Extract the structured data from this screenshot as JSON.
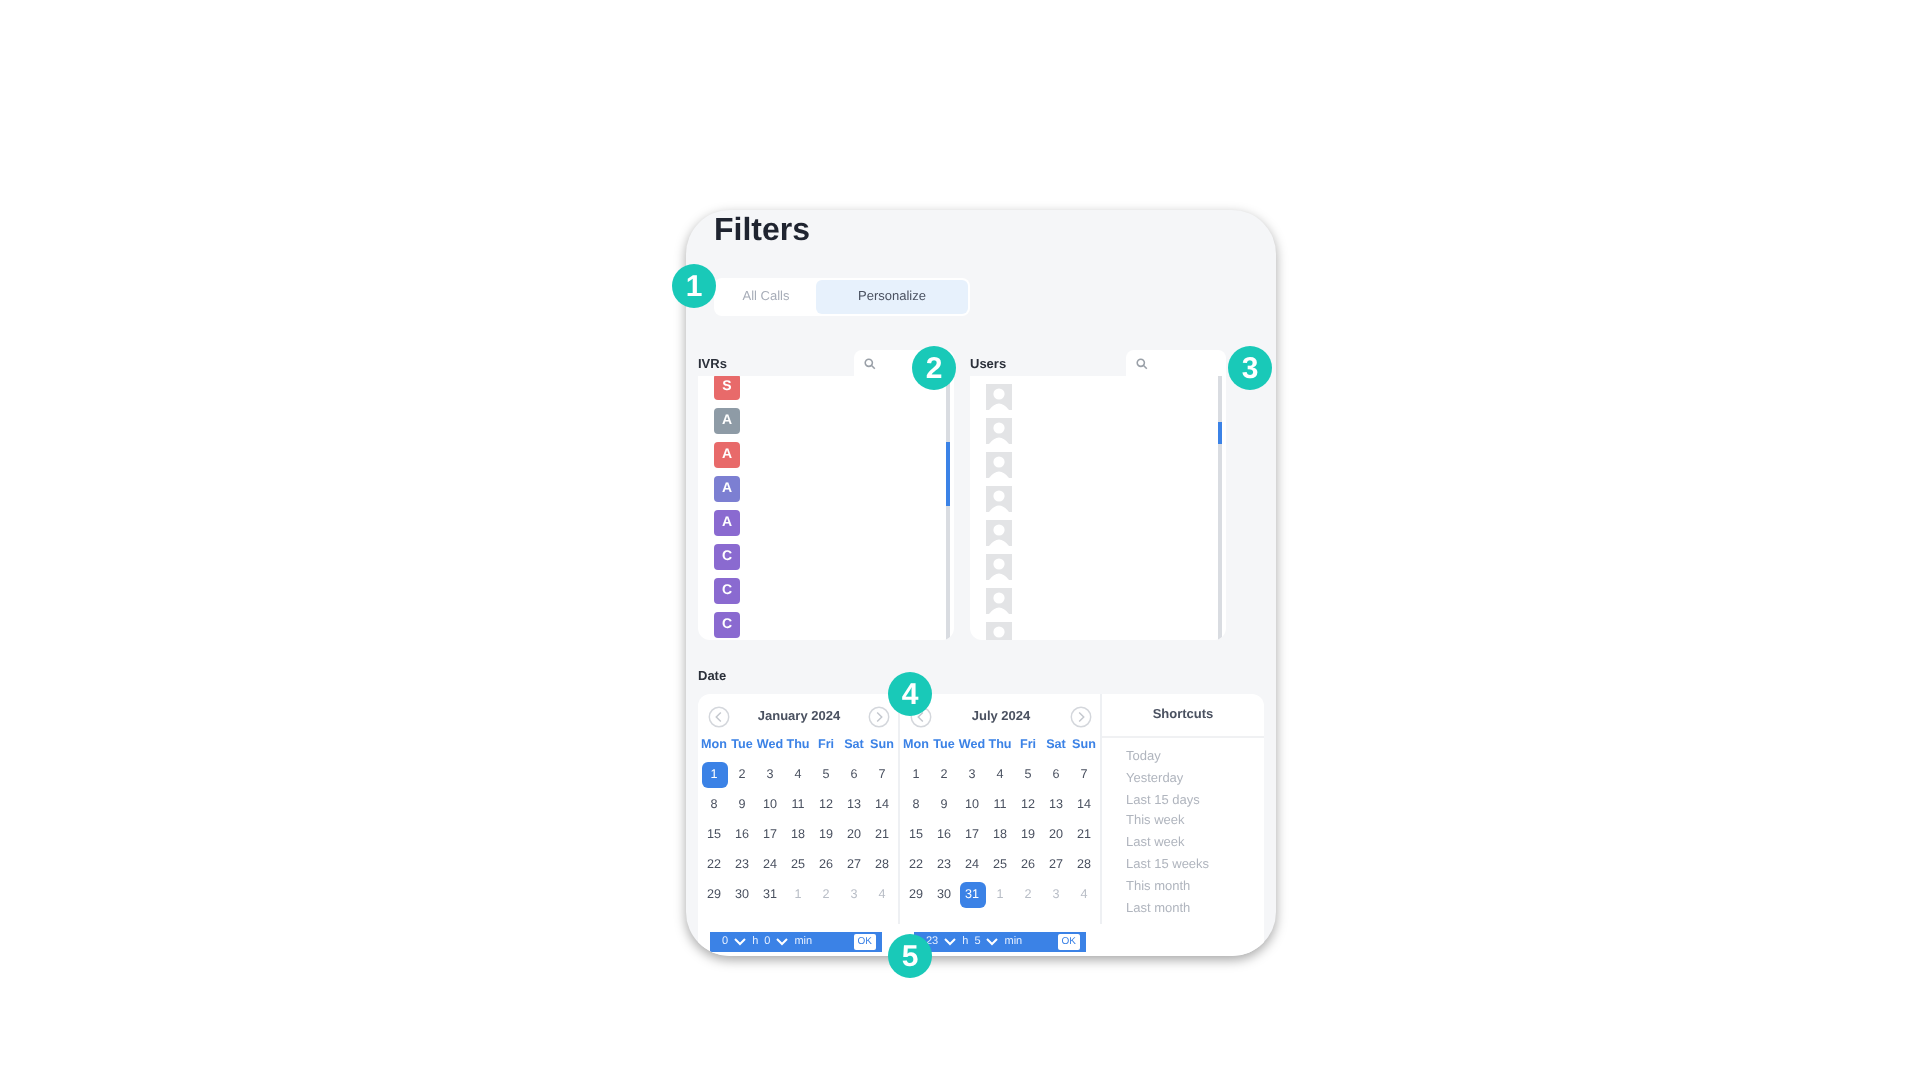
{
  "title": "Filters",
  "tabs": [
    {
      "label": "All Calls",
      "selected": false
    },
    {
      "label": "Personalize",
      "selected": true
    }
  ],
  "ivrs": {
    "label": "IVRs",
    "items": [
      {
        "initial": "S",
        "color": "#e86a6a"
      },
      {
        "initial": "A",
        "color": "#8e9ba6"
      },
      {
        "initial": "A",
        "color": "#e86a6a"
      },
      {
        "initial": "A",
        "color": "#7c7fd2"
      },
      {
        "initial": "A",
        "color": "#8a6ad0"
      },
      {
        "initial": "C",
        "color": "#8a6ad0"
      },
      {
        "initial": "C",
        "color": "#8a6ad0"
      },
      {
        "initial": "C",
        "color": "#8a6ad0"
      }
    ]
  },
  "users": {
    "label": "Users",
    "items": [
      {
        "kind": "avatar"
      },
      {
        "kind": "avatar"
      },
      {
        "kind": "avatar"
      },
      {
        "kind": "avatar"
      },
      {
        "kind": "avatar"
      },
      {
        "kind": "avatar"
      },
      {
        "kind": "avatar"
      },
      {
        "kind": "avatar"
      }
    ]
  },
  "date": {
    "label": "Date",
    "months": [
      {
        "title": "January 2024",
        "weekdays": [
          "Mon",
          "Tue",
          "Wed",
          "Thu",
          "Fri",
          "Sat",
          "Sun"
        ],
        "days": [
          {
            "day": "1",
            "selected": true,
            "muted": false
          },
          {
            "day": "2",
            "selected": false,
            "muted": false
          },
          {
            "day": "3",
            "selected": false,
            "muted": false
          },
          {
            "day": "4",
            "selected": false,
            "muted": false
          },
          {
            "day": "5",
            "selected": false,
            "muted": false
          },
          {
            "day": "6",
            "selected": false,
            "muted": false
          },
          {
            "day": "7",
            "selected": false,
            "muted": false
          },
          {
            "day": "8",
            "selected": false,
            "muted": false
          },
          {
            "day": "9",
            "selected": false,
            "muted": false
          },
          {
            "day": "10",
            "selected": false,
            "muted": false
          },
          {
            "day": "11",
            "selected": false,
            "muted": false
          },
          {
            "day": "12",
            "selected": false,
            "muted": false
          },
          {
            "day": "13",
            "selected": false,
            "muted": false
          },
          {
            "day": "14",
            "selected": false,
            "muted": false
          },
          {
            "day": "15",
            "selected": false,
            "muted": false
          },
          {
            "day": "16",
            "selected": false,
            "muted": false
          },
          {
            "day": "17",
            "selected": false,
            "muted": false
          },
          {
            "day": "18",
            "selected": false,
            "muted": false
          },
          {
            "day": "19",
            "selected": false,
            "muted": false
          },
          {
            "day": "20",
            "selected": false,
            "muted": false
          },
          {
            "day": "21",
            "selected": false,
            "muted": false
          },
          {
            "day": "22",
            "selected": false,
            "muted": false
          },
          {
            "day": "23",
            "selected": false,
            "muted": false
          },
          {
            "day": "24",
            "selected": false,
            "muted": false
          },
          {
            "day": "25",
            "selected": false,
            "muted": false
          },
          {
            "day": "26",
            "selected": false,
            "muted": false
          },
          {
            "day": "27",
            "selected": false,
            "muted": false
          },
          {
            "day": "28",
            "selected": false,
            "muted": false
          },
          {
            "day": "29",
            "selected": false,
            "muted": false
          },
          {
            "day": "30",
            "selected": false,
            "muted": false
          },
          {
            "day": "31",
            "selected": false,
            "muted": false
          },
          {
            "day": "1",
            "selected": false,
            "muted": true
          },
          {
            "day": "2",
            "selected": false,
            "muted": true
          },
          {
            "day": "3",
            "selected": false,
            "muted": true
          },
          {
            "day": "4",
            "selected": false,
            "muted": true
          }
        ]
      },
      {
        "title": "July 2024",
        "weekdays": [
          "Mon",
          "Tue",
          "Wed",
          "Thu",
          "Fri",
          "Sat",
          "Sun"
        ],
        "days": [
          {
            "day": "1",
            "selected": false,
            "muted": false
          },
          {
            "day": "2",
            "selected": false,
            "muted": false
          },
          {
            "day": "3",
            "selected": false,
            "muted": false
          },
          {
            "day": "4",
            "selected": false,
            "muted": false
          },
          {
            "day": "5",
            "selected": false,
            "muted": false
          },
          {
            "day": "6",
            "selected": false,
            "muted": false
          },
          {
            "day": "7",
            "selected": false,
            "muted": false
          },
          {
            "day": "8",
            "selected": false,
            "muted": false
          },
          {
            "day": "9",
            "selected": false,
            "muted": false
          },
          {
            "day": "10",
            "selected": false,
            "muted": false
          },
          {
            "day": "11",
            "selected": false,
            "muted": false
          },
          {
            "day": "12",
            "selected": false,
            "muted": false
          },
          {
            "day": "13",
            "selected": false,
            "muted": false
          },
          {
            "day": "14",
            "selected": false,
            "muted": false
          },
          {
            "day": "15",
            "selected": false,
            "muted": false
          },
          {
            "day": "16",
            "selected": false,
            "muted": false
          },
          {
            "day": "17",
            "selected": false,
            "muted": false
          },
          {
            "day": "18",
            "selected": false,
            "muted": false
          },
          {
            "day": "19",
            "selected": false,
            "muted": false
          },
          {
            "day": "20",
            "selected": false,
            "muted": false
          },
          {
            "day": "21",
            "selected": false,
            "muted": false
          },
          {
            "day": "22",
            "selected": false,
            "muted": false
          },
          {
            "day": "23",
            "selected": false,
            "muted": false
          },
          {
            "day": "24",
            "selected": false,
            "muted": false
          },
          {
            "day": "25",
            "selected": false,
            "muted": false
          },
          {
            "day": "26",
            "selected": false,
            "muted": false
          },
          {
            "day": "27",
            "selected": false,
            "muted": false
          },
          {
            "day": "28",
            "selected": false,
            "muted": false
          },
          {
            "day": "29",
            "selected": false,
            "muted": false
          },
          {
            "day": "30",
            "selected": false,
            "muted": false
          },
          {
            "day": "31",
            "selected": true,
            "muted": false
          },
          {
            "day": "1",
            "selected": false,
            "muted": true
          },
          {
            "day": "2",
            "selected": false,
            "muted": true
          },
          {
            "day": "3",
            "selected": false,
            "muted": true
          },
          {
            "day": "4",
            "selected": false,
            "muted": true
          }
        ]
      }
    ],
    "shortcuts": {
      "title": "Shortcuts",
      "items": [
        "Today",
        "Yesterday",
        "Last 15 days",
        "This week",
        "Last week",
        "Last 15 weeks",
        "This month",
        "Last month"
      ]
    },
    "time_pickers": [
      {
        "hour": "0",
        "hour_unit": "h",
        "minute": "0",
        "minute_unit": "min",
        "button": "OK"
      },
      {
        "hour": "23",
        "hour_unit": "h",
        "minute": "5",
        "minute_unit": "min",
        "button": "OK"
      }
    ]
  },
  "callouts": [
    "1",
    "2",
    "3",
    "4",
    "5"
  ]
}
